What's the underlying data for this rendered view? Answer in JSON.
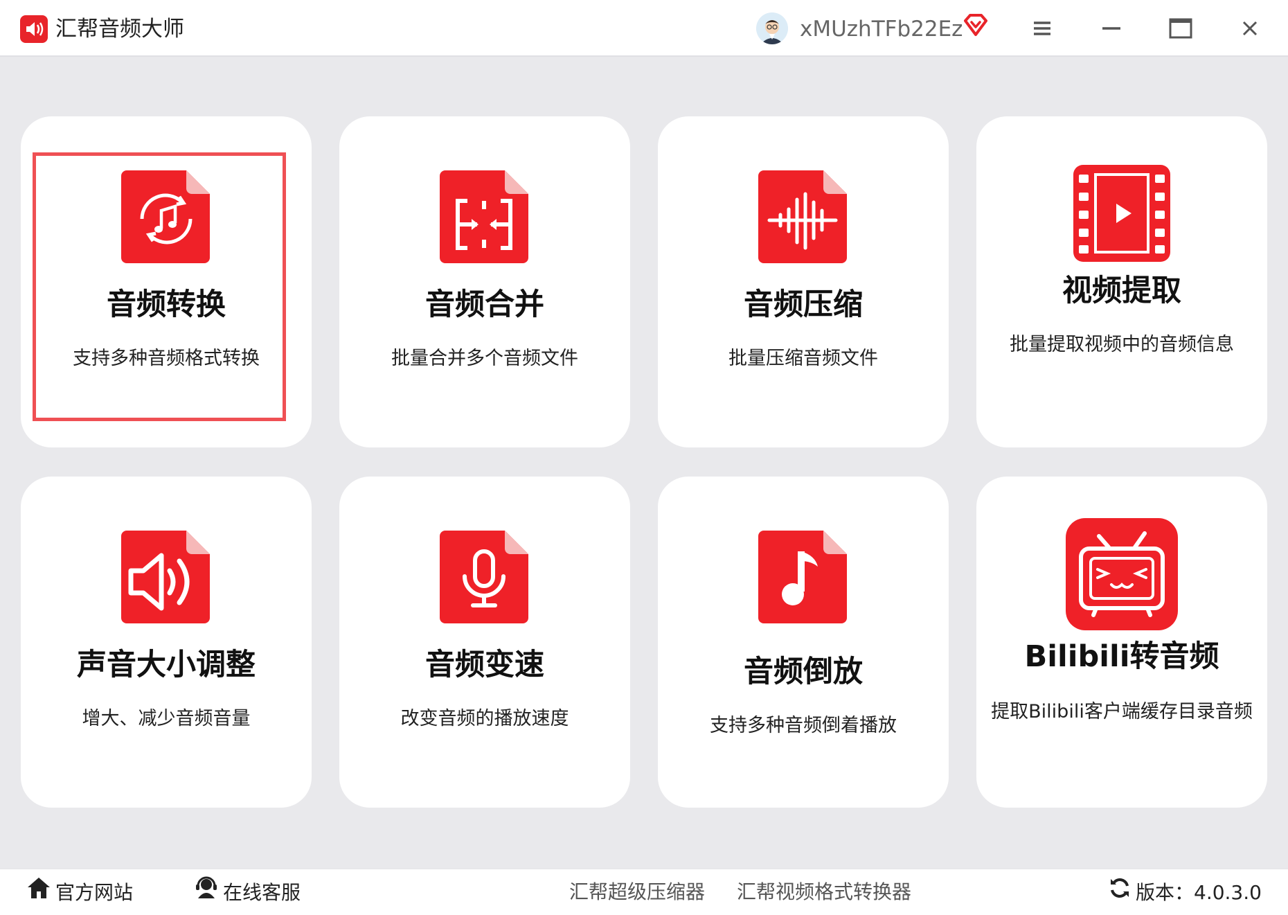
{
  "app": {
    "title": "汇帮音频大师",
    "username": "xMUzhTFb22Ez"
  },
  "colors": {
    "accent": "#e8242a",
    "selection": "#ef5054"
  },
  "cards": [
    {
      "id": "audio-convert",
      "title": "音频转换",
      "desc": "支持多种音频格式转换",
      "icon": "music-convert-icon",
      "selected": true
    },
    {
      "id": "audio-merge",
      "title": "音频合并",
      "desc": "批量合并多个音频文件",
      "icon": "merge-icon"
    },
    {
      "id": "audio-compress",
      "title": "音频压缩",
      "desc": "批量压缩音频文件",
      "icon": "waveform-compress-icon"
    },
    {
      "id": "video-extract",
      "title": "视频提取",
      "desc": "批量提取视频中的音频信息",
      "icon": "film-play-icon"
    },
    {
      "id": "volume-adjust",
      "title": "声音大小调整",
      "desc": "增大、减少音频音量",
      "icon": "speaker-icon"
    },
    {
      "id": "audio-speed",
      "title": "音频变速",
      "desc": "改变音频的播放速度",
      "icon": "microphone-icon"
    },
    {
      "id": "audio-reverse",
      "title": "音频倒放",
      "desc": "支持多种音频倒着播放",
      "icon": "music-note-icon"
    },
    {
      "id": "bilibili",
      "title": "Bilibili转音频",
      "desc": "提取Bilibili客户端缓存目录音频",
      "icon": "bilibili-tv-icon"
    }
  ],
  "footer": {
    "website": "官方网站",
    "support": "在线客服",
    "link1": "汇帮超级压缩器",
    "link2": "汇帮视频格式转换器",
    "version": "版本：4.0.3.0"
  }
}
